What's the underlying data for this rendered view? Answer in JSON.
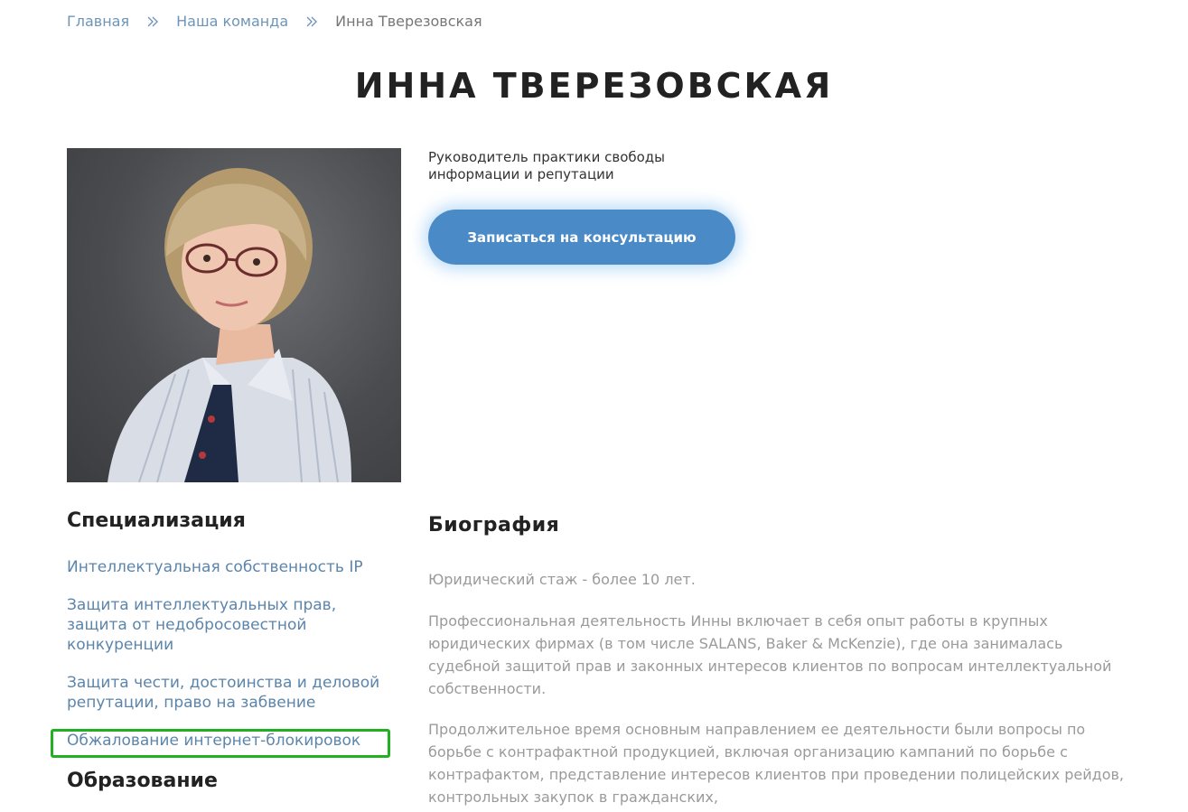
{
  "breadcrumb": {
    "home": "Главная",
    "team": "Наша команда",
    "current": "Инна Тверезовская"
  },
  "title": "ИННА ТВЕРЕЗОВСКАЯ",
  "position": "Руководитель практики свободы информации и репутации",
  "cta_label": "Записаться на консультацию",
  "specialization": {
    "heading": "Специализация",
    "items": [
      "Интеллектуальная собственность IP",
      "Защита интеллектуальных прав, защита от недобросовестной конкуренции",
      "Защита чести, достоинства и деловой репутации, право на забвение",
      "Обжалование интернет-блокировок"
    ]
  },
  "education": {
    "heading": "Образование"
  },
  "biography": {
    "heading": "Биография",
    "paragraphs": [
      "Юридический стаж - более 10 лет.",
      "Профессиональная деятельность Инны включает в себя опыт работы в крупных юридических фирмах (в том числе  SALANS, Baker & McKenzie), где она занималась судебной защитой прав и законных интересов клиентов по вопросам интеллектуальной собственности.",
      "Продолжительное время основным направлением ее деятельности были вопросы по борьбе с контрафактной продукцией, включая организацию кампаний по борьбе с контрафактом, представление интересов клиентов при проведении полицейских рейдов, контрольных закупок в гражданских,"
    ]
  },
  "colors": {
    "link": "#6e95b8",
    "accent": "#4a8ac6",
    "highlight": "#22b022"
  }
}
